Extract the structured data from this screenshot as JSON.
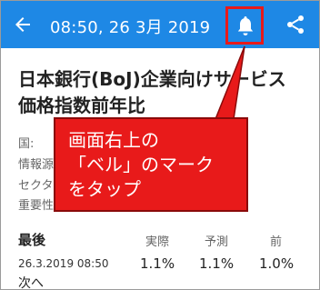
{
  "appbar": {
    "title": "08:50, 26 3月 2019",
    "back_icon": "arrow-back-icon",
    "bell_icon": "bell-icon",
    "share_icon": "share-icon",
    "color": "#1e88e5"
  },
  "article": {
    "headline_line1": "日本銀行(BoJ)企業向けサービス",
    "headline_line2": "価格指数前年比"
  },
  "meta": {
    "country_label": "国:",
    "source_label": "情報源",
    "sector_label": "セクタ",
    "importance_label": "重要性"
  },
  "callout": {
    "line1": "画面右上の",
    "line2": "「ベル」のマーク",
    "line3": "をタップ",
    "color": "#e81a1a"
  },
  "table": {
    "latest_label": "最後",
    "actual_label": "実際",
    "forecast_label": "予測",
    "previous_label": "前",
    "date": "26.3.2019 08:50",
    "actual": "1.1%",
    "forecast": "1.1%",
    "previous": "1.0%",
    "next_label": "次へ"
  }
}
